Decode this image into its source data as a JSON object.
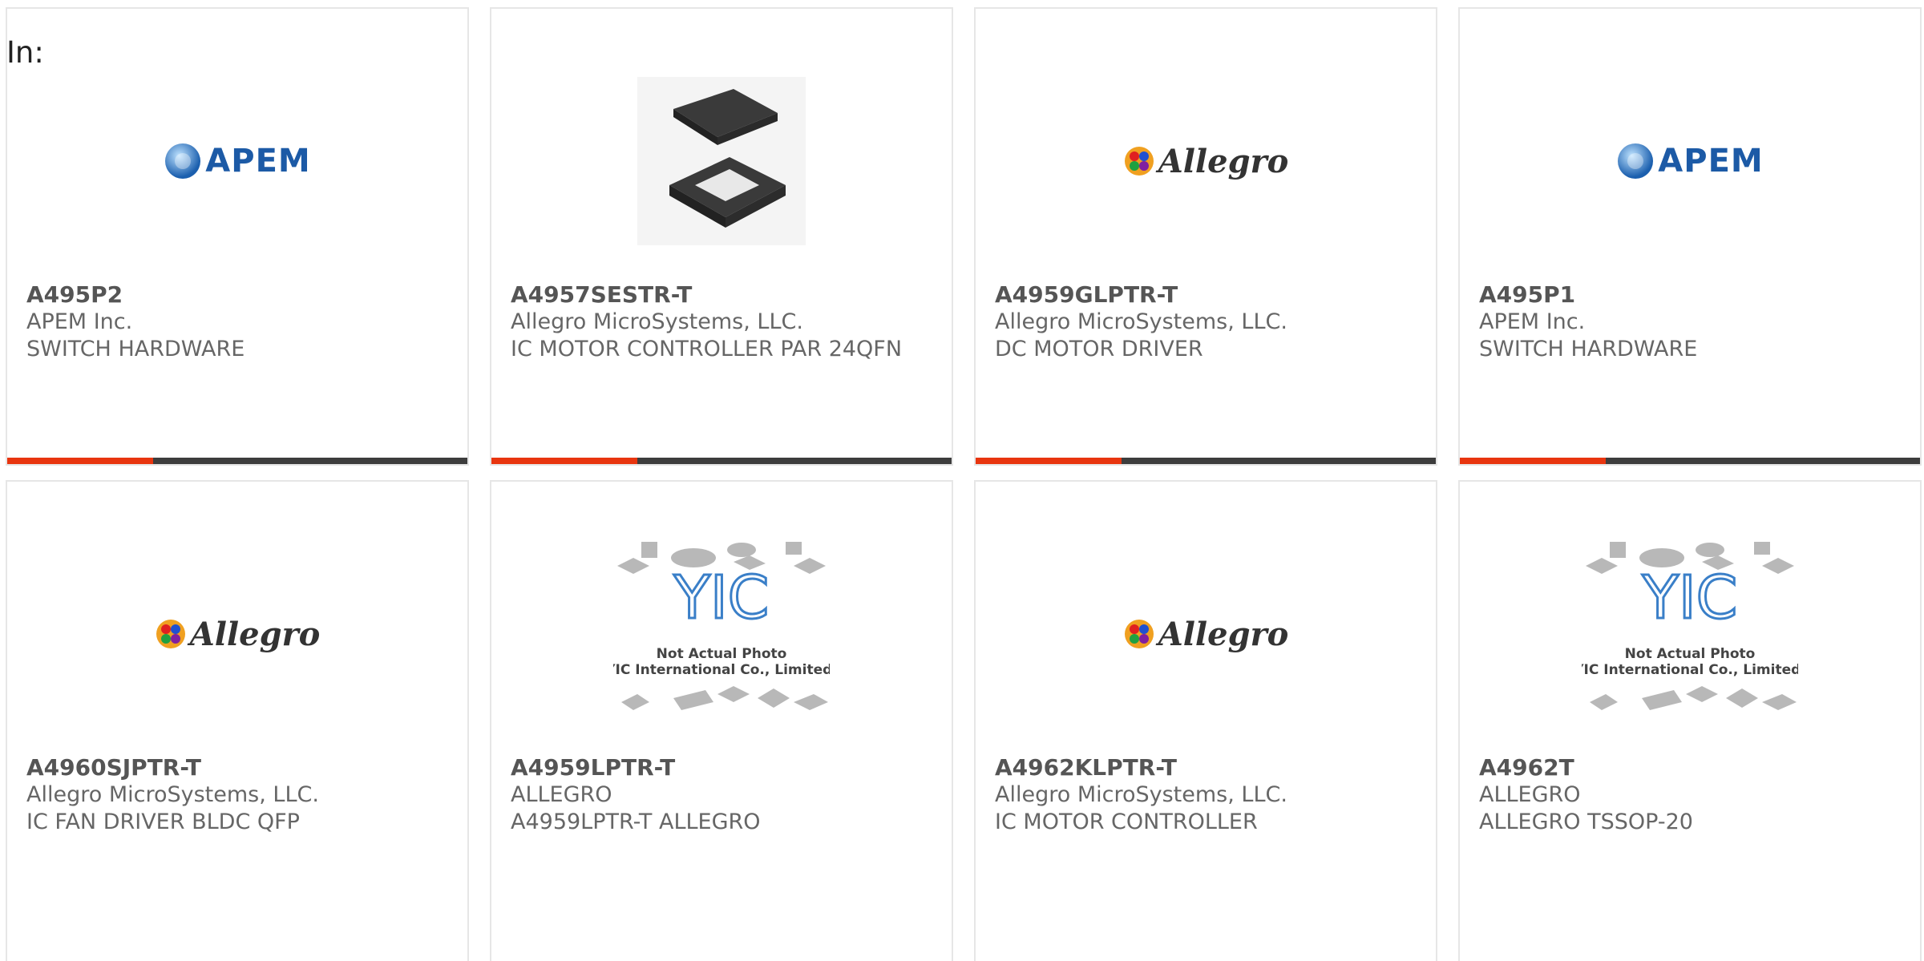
{
  "filter_label": "In:",
  "colors": {
    "accent": "#e8350f",
    "bar": "#3d3d3d",
    "apem_blue": "#1c5aa6"
  },
  "products": [
    {
      "part_number": "A495P2",
      "manufacturer": "APEM Inc.",
      "description": "SWITCH HARDWARE",
      "image": "apem-logo"
    },
    {
      "part_number": "A4957SESTR-T",
      "manufacturer": "Allegro MicroSystems, LLC.",
      "description": "IC MOTOR CONTROLLER PAR 24QFN",
      "image": "qfn-chip-photo"
    },
    {
      "part_number": "A4959GLPTR-T",
      "manufacturer": "Allegro MicroSystems, LLC.",
      "description": "DC MOTOR DRIVER",
      "image": "allegro-logo"
    },
    {
      "part_number": "A495P1",
      "manufacturer": "APEM Inc.",
      "description": "SWITCH HARDWARE",
      "image": "apem-logo"
    },
    {
      "part_number": "A4960SJPTR-T",
      "manufacturer": "Allegro MicroSystems, LLC.",
      "description": "IC FAN DRIVER BLDC QFP",
      "image": "allegro-logo"
    },
    {
      "part_number": "A4959LPTR-T",
      "manufacturer": "ALLEGRO",
      "description": "A4959LPTR-T ALLEGRO",
      "image": "yic-placeholder",
      "placeholder_line1": "Not Actual Photo",
      "placeholder_line2": "YIC International Co., Limited."
    },
    {
      "part_number": "A4962KLPTR-T",
      "manufacturer": "Allegro MicroSystems, LLC.",
      "description": "IC MOTOR CONTROLLER",
      "image": "allegro-logo"
    },
    {
      "part_number": "A4962T",
      "manufacturer": "ALLEGRO",
      "description": "ALLEGRO TSSOP-20",
      "image": "yic-placeholder",
      "placeholder_line1": "Not Actual Photo",
      "placeholder_line2": "YIC International Co., Limited."
    }
  ],
  "logos": {
    "apem": "APEM",
    "allegro": "Allegro",
    "allegro_sub": "MicroSystems, LLC",
    "yic": "YIC"
  }
}
